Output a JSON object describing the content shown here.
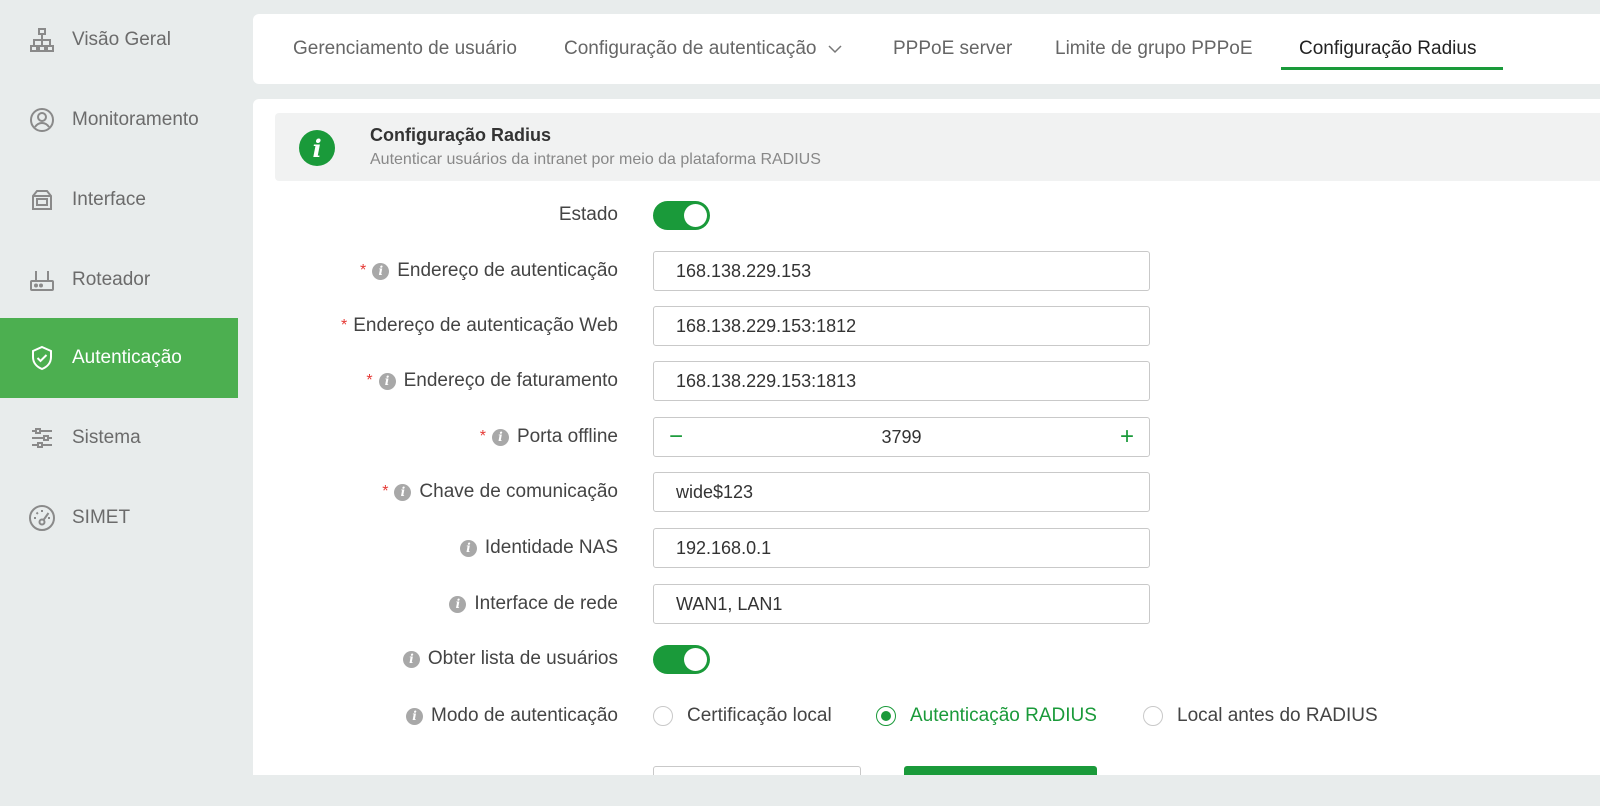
{
  "sidebar": {
    "items": [
      {
        "label": "Visão Geral",
        "icon": "sitemap-icon"
      },
      {
        "label": "Monitoramento",
        "icon": "user-circle-icon"
      },
      {
        "label": "Interface",
        "icon": "interface-icon"
      },
      {
        "label": "Roteador",
        "icon": "router-icon"
      },
      {
        "label": "Autenticação",
        "icon": "shield-check-icon",
        "active": true
      },
      {
        "label": "Sistema",
        "icon": "sliders-icon"
      },
      {
        "label": "SIMET",
        "icon": "gauge-icon"
      }
    ]
  },
  "tabs": [
    {
      "label": "Gerenciamento de usuário"
    },
    {
      "label": "Configuração de autenticação",
      "has_dropdown": true
    },
    {
      "label": "PPPoE server"
    },
    {
      "label": "Limite de grupo PPPoE"
    },
    {
      "label": "Configuração Radius",
      "active": true
    }
  ],
  "banner": {
    "icon": "info-icon",
    "title": "Configuração Radius",
    "subtitle": "Autenticar usuários da intranet por meio da plataforma RADIUS"
  },
  "form": {
    "estado": {
      "label": "Estado",
      "on": true
    },
    "auth_address": {
      "label": "Endereço de autenticação",
      "value": "168.138.229.153",
      "required": true
    },
    "web_auth_address": {
      "label": "Endereço de autenticação Web",
      "value": "168.138.229.153:1812",
      "required": true
    },
    "billing_address": {
      "label": "Endereço de faturamento",
      "value": "168.138.229.153:1813",
      "required": true
    },
    "offline_port": {
      "label": "Porta offline",
      "value": "3799",
      "required": true,
      "minus": "−",
      "plus": "+"
    },
    "comm_key": {
      "label": "Chave de comunicação",
      "value": "wide$123",
      "required": true
    },
    "nas_identity": {
      "label": "Identidade NAS",
      "value": "192.168.0.1"
    },
    "network_interface": {
      "label": "Interface de rede",
      "value": "WAN1, LAN1"
    },
    "get_user_list": {
      "label": "Obter lista de usuários",
      "on": true
    },
    "auth_mode": {
      "label": "Modo de autenticação",
      "options": [
        "Certificação local",
        "Autenticação RADIUS",
        "Local antes do RADIUS"
      ],
      "selected": "Autenticação RADIUS"
    }
  },
  "required_mark": "*",
  "info_mark": "i",
  "colors": {
    "accent": "#1a9a3a",
    "sidebar_active": "#4caf50",
    "required": "#e53935"
  }
}
